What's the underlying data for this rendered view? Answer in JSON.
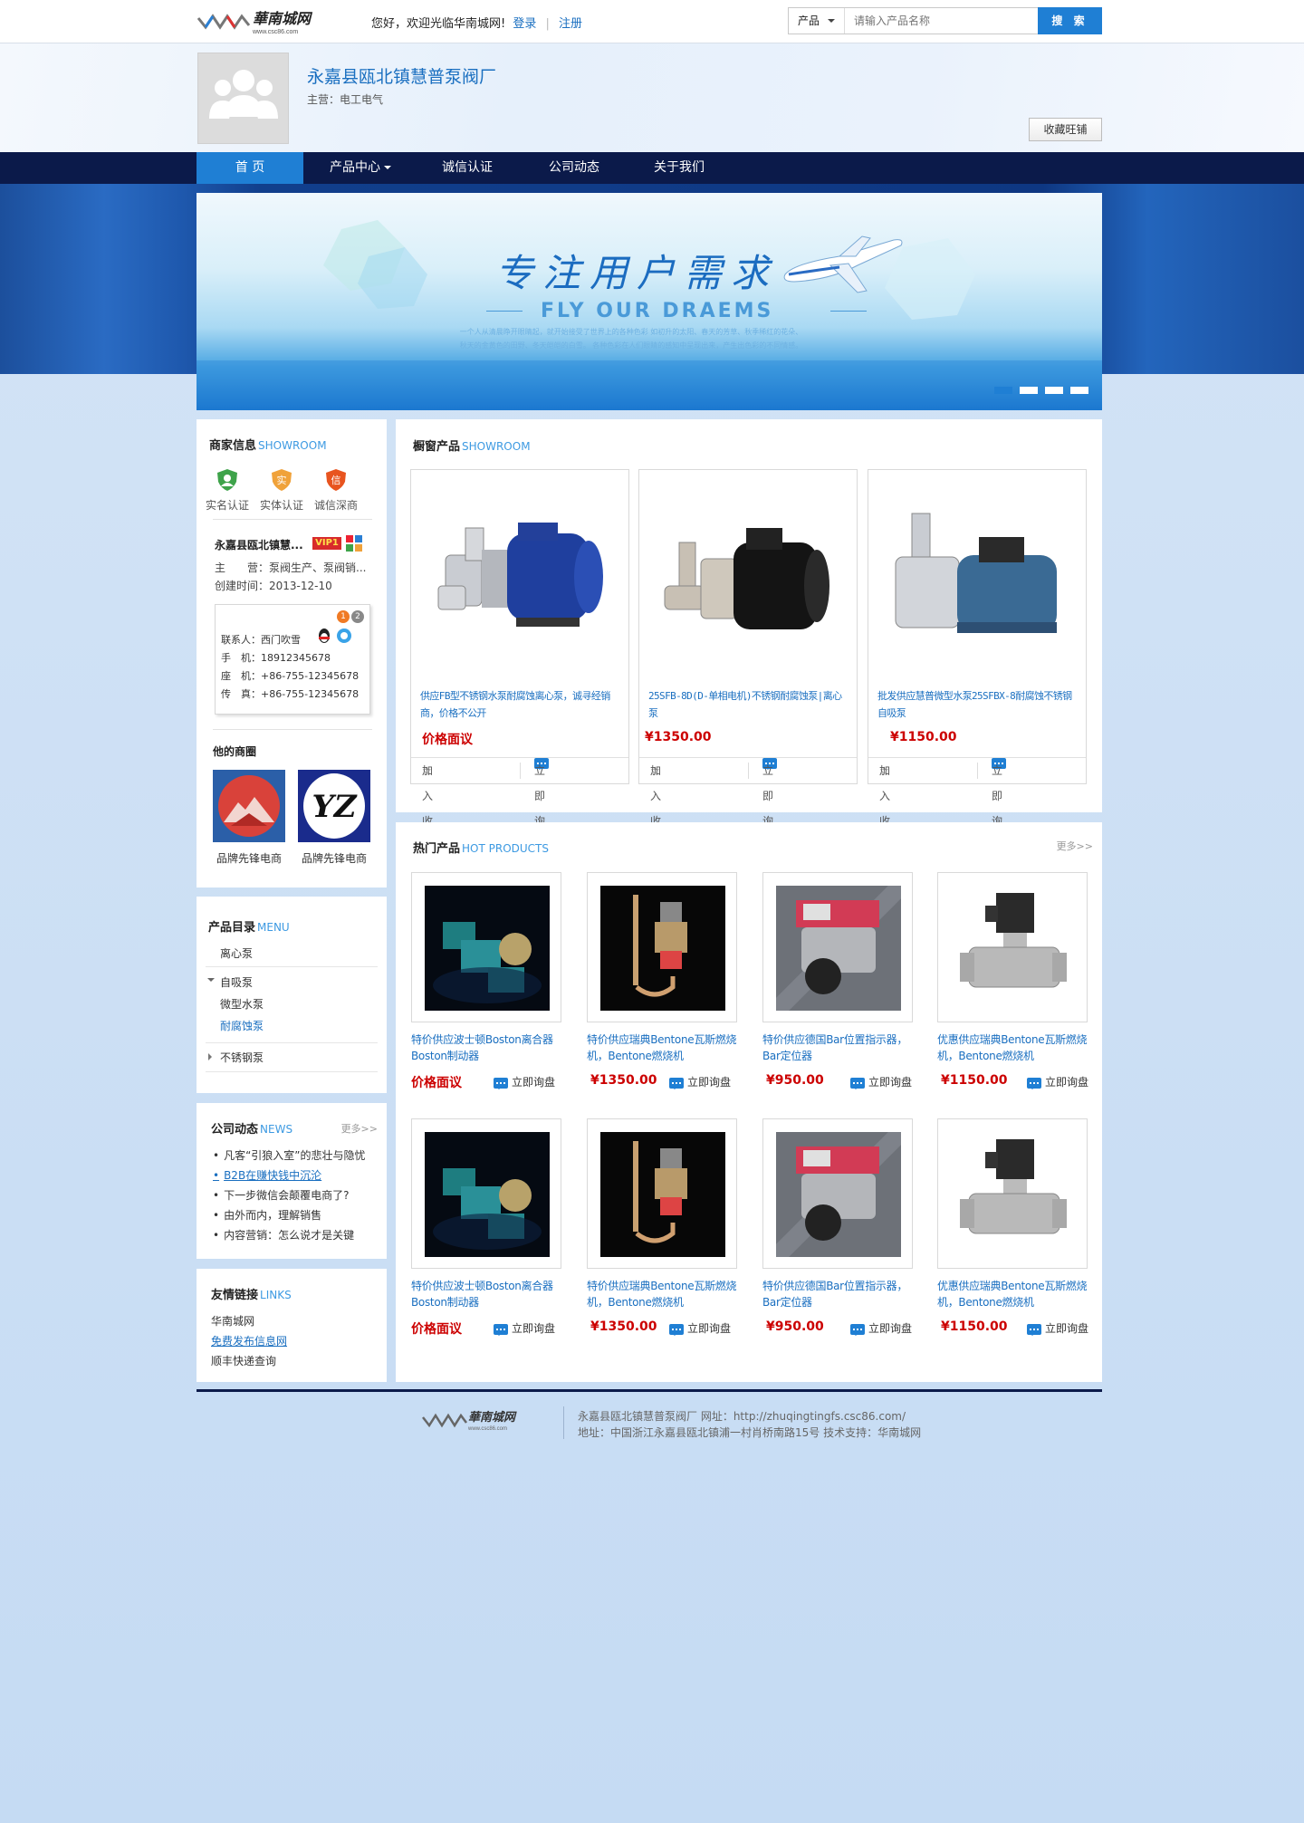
{
  "topbar": {
    "logo_text": "華南城网",
    "logo_sub": "www.csc86.com",
    "greeting": "您好，欢迎光临华南城网!",
    "login": "登录",
    "register": "注册",
    "search_category": "产品",
    "search_placeholder": "请输入产品名称",
    "search_button": "搜 索"
  },
  "header": {
    "company_name": "永嘉县瓯北镇慧普泵阀厂",
    "main_business": "主营：电工电气",
    "favorite_button": "收藏旺铺"
  },
  "nav": {
    "items": [
      {
        "label": "首 页"
      },
      {
        "label": "产品中心"
      },
      {
        "label": "诚信认证"
      },
      {
        "label": "公司动态"
      },
      {
        "label": "关于我们"
      }
    ]
  },
  "banner": {
    "slogan": "专注用户需求",
    "subtitle": "FLY OUR DRAEMS",
    "small_text": "一个人从清晨睁开眼睛起，就开始接受了世界上的各种色彩 如初升的太阳、春天的芳草、秋季稀红的花朵、秋天的金黄色的田野、冬天皑皑的白雪。 各种色彩在人们眼睛的感知中呈现出来，产生出色彩的不同情感。"
  },
  "merchant": {
    "title": "商家信息",
    "title_en": "SHOWROOM",
    "badges": [
      "实名认证",
      "实体认证",
      "诚信深商"
    ],
    "shop_name": "永嘉县瓯北镇慧...",
    "vip": "VIP1",
    "main_label": "主　　营：",
    "main_value": "泵阀生产、泵阀销...",
    "created_label": "创建时间：",
    "created_value": "2013-12-10",
    "contact_nums": [
      "1",
      "2"
    ],
    "contact": [
      {
        "label": "联系人：",
        "value": "西门吹雪"
      },
      {
        "label": "手　机：",
        "value": "18912345678"
      },
      {
        "label": "座　机：",
        "value": "+86-755-12345678"
      },
      {
        "label": "传　真：",
        "value": "+86-755-12345678"
      }
    ],
    "brands_title": "他的商圈",
    "brands": [
      {
        "label": "品牌先锋电商"
      },
      {
        "label": "品牌先锋电商",
        "logo_text": "YZ"
      }
    ]
  },
  "menu": {
    "title": "产品目录",
    "title_en": "MENU",
    "items": [
      "离心泵",
      "自吸泵",
      "微型水泵",
      "耐腐蚀泵",
      "不锈钢泵"
    ]
  },
  "news": {
    "title": "公司动态",
    "title_en": "NEWS",
    "more": "更多>>",
    "items": [
      "凡客“引狼入室”的悲壮与隐忧",
      "B2B在赚快钱中沉沦",
      "下一步微信会颠覆电商了?",
      "由外而内，理解销售",
      "内容营销：怎么说才是关键"
    ]
  },
  "links": {
    "title": "友情链接",
    "title_en": "LINKS",
    "items": [
      "华南城网",
      "免费发布信息网",
      "顺丰快递查询"
    ]
  },
  "showroom": {
    "title": "橱窗产品",
    "title_en": "SHOWROOM",
    "fav_label": "加入收藏",
    "inquiry_label": "立即询盘",
    "products": [
      {
        "title": "供应FB型不锈钢水泵耐腐蚀离心泵，诚寻经销商，价格不公开",
        "price": "价格面议"
      },
      {
        "title": "25SFB-8D(D-单相电机)不锈钢耐腐蚀泵|离心泵",
        "price": "¥1350.00"
      },
      {
        "title": "批发供应慧普微型水泵25SFBX-8耐腐蚀不锈钢自吸泵",
        "price": "¥1150.00"
      }
    ]
  },
  "hot": {
    "title": "热门产品",
    "title_en": "HOT PRODUCTS",
    "more": "更多>>",
    "inquiry_label": "立即询盘",
    "rows": [
      [
        {
          "title": "特价供应波士顿Boston离合器Boston制动器",
          "price": "价格面议"
        },
        {
          "title": "特价供应瑞典Bentone瓦斯燃烧机，Bentone燃烧机",
          "price": "¥1350.00"
        },
        {
          "title": "特价供应德国Bar位置指示器，Bar定位器",
          "price": "¥950.00"
        },
        {
          "title": "优惠供应瑞典Bentone瓦斯燃烧机，Bentone燃烧机",
          "price": "¥1150.00"
        }
      ],
      [
        {
          "title": "特价供应波士顿Boston离合器Boston制动器",
          "price": "价格面议"
        },
        {
          "title": "特价供应瑞典Bentone瓦斯燃烧机，Bentone燃烧机",
          "price": "¥1350.00"
        },
        {
          "title": "特价供应德国Bar位置指示器，Bar定位器",
          "price": "¥950.00"
        },
        {
          "title": "优惠供应瑞典Bentone瓦斯燃烧机，Bentone燃烧机",
          "price": "¥1150.00"
        }
      ]
    ]
  },
  "footer": {
    "line1": "永嘉县瓯北镇慧普泵阀厂  网址：http://zhuqingtingfs.csc86.com/",
    "line2": "地址：中国浙江永嘉县瓯北镇浦一村肖桥南路15号  技术支持：华南城网"
  },
  "colors": {
    "accent": "#1f7fd4",
    "nav_bg": "#0b1a4a",
    "price_red": "#cc0000",
    "link_blue": "#1a6fc0",
    "page_bg": "#c9ddf4"
  }
}
